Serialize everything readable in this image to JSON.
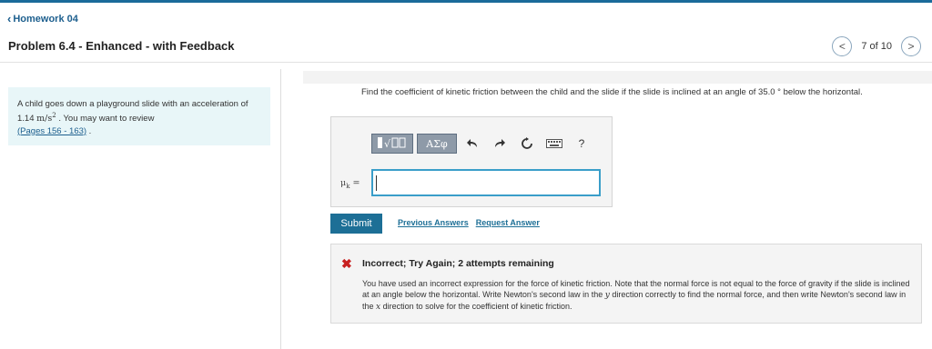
{
  "nav": {
    "back_label": "Homework 04"
  },
  "header": {
    "problem_title": "Problem 6.4 - Enhanced - with Feedback"
  },
  "pager": {
    "text": "7 of 10",
    "prev_symbol": "<",
    "next_symbol": ">"
  },
  "left_panel": {
    "text_before": "A child goes down a playground slide with an acceleration of 1.14 ",
    "unit": "m/s",
    "unit_exp": "2",
    "text_after": " . You may want to review",
    "link": "(Pages 156 - 163)",
    "link_suffix": " ."
  },
  "question": {
    "text": "Find the coefficient of kinetic friction between the child and the slide if the slide is inclined at an angle of 35.0 ° below the horizontal."
  },
  "toolbar": {
    "template_icon": "template-icon",
    "greek_label": "ΑΣφ",
    "undo_icon": "undo-icon",
    "redo_icon": "redo-icon",
    "reset_icon": "reset-icon",
    "keyboard_icon": "keyboard-icon",
    "help_label": "?"
  },
  "answer": {
    "label_var": "μ",
    "label_sub": "k",
    "label_eq": " =",
    "value": ""
  },
  "actions": {
    "submit_label": "Submit",
    "previous_answers_label": "Previous Answers",
    "request_answer_label": "Request Answer"
  },
  "feedback": {
    "status_icon": "close-icon",
    "title": "Incorrect; Try Again; 2 attempts remaining",
    "body_1": "You have used an incorrect expression for the force of kinetic friction. Note that the normal force is not equal to the force of gravity if the slide is inclined at an angle below the horizontal. Write Newton's second law in the ",
    "var_y": "y",
    "body_2": " direction correctly to find the normal force, and then write Newton's second law in the ",
    "var_x": "x",
    "body_3": " direction to solve for the coefficient of kinetic friction."
  },
  "colors": {
    "accent": "#1d6f96",
    "error": "#c82020",
    "info_bg": "#e8f6f8"
  }
}
